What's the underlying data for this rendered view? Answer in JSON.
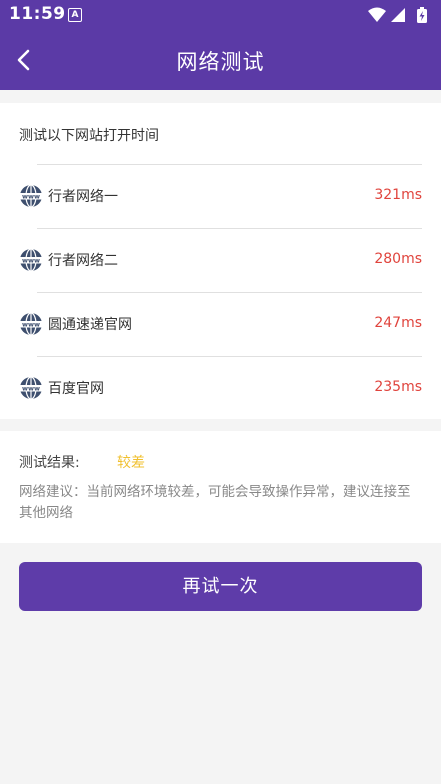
{
  "status_bar": {
    "time": "11:59",
    "notification_glyph": "A",
    "icons": [
      "wifi-icon",
      "signal-icon",
      "battery-charging-icon"
    ]
  },
  "header": {
    "back_icon": "back-arrow-icon",
    "title": "网络测试"
  },
  "sites_card": {
    "heading": "测试以下网站打开时间",
    "icon": "globe-www-icon",
    "sites": [
      {
        "name": "行者网络一",
        "time": "321ms"
      },
      {
        "name": "行者网络二",
        "time": "280ms"
      },
      {
        "name": "圆通速递官网",
        "time": "247ms"
      },
      {
        "name": "百度官网",
        "time": "235ms"
      }
    ]
  },
  "result_card": {
    "label": "测试结果:",
    "value": "较差",
    "advice": "网络建议：当前网络环境较差，可能会导致操作异常，建议连接至其他网络"
  },
  "retry_button": {
    "label": "再试一次"
  },
  "colors": {
    "primary": "#5b3aa6",
    "latency": "#e0443d",
    "result_value": "#f0c030"
  }
}
